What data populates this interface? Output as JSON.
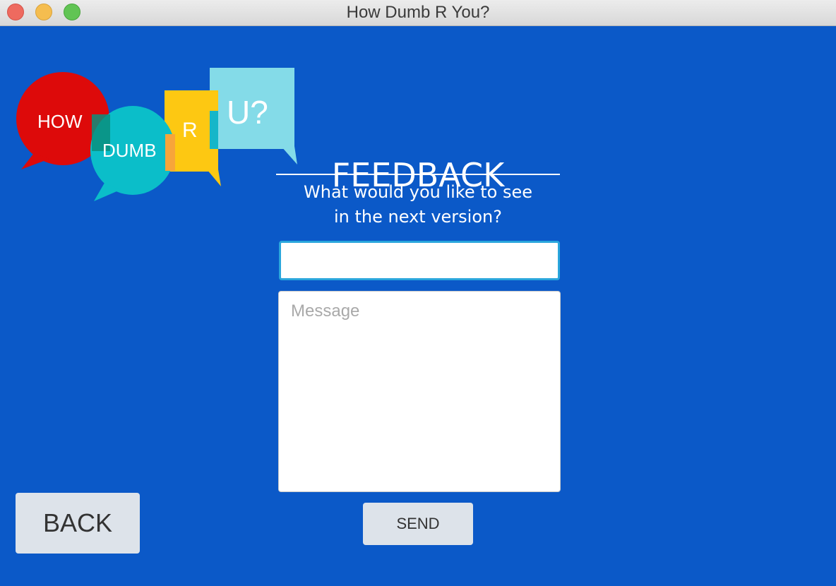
{
  "window": {
    "title": "How Dumb R You?",
    "controls": [
      "close",
      "minimize",
      "maximize"
    ]
  },
  "logo": {
    "words": [
      "HOW",
      "DUMB",
      "R",
      "U?"
    ],
    "colors": {
      "how": "#dd0a0a",
      "dumb": "#0bbec9",
      "r": "#fdc812",
      "u": "#84dbe8"
    }
  },
  "feedback": {
    "heading": "FEEDBACK",
    "subtitle_line1": "What would you like to see",
    "subtitle_line2": "in the next version?",
    "input_value": "",
    "message_placeholder": "Message",
    "send_label": "SEND"
  },
  "nav": {
    "back_label": "BACK"
  },
  "theme": {
    "background": "#0b59c8",
    "button": "#dde3ea",
    "input_focus": "#2aa6dc"
  }
}
